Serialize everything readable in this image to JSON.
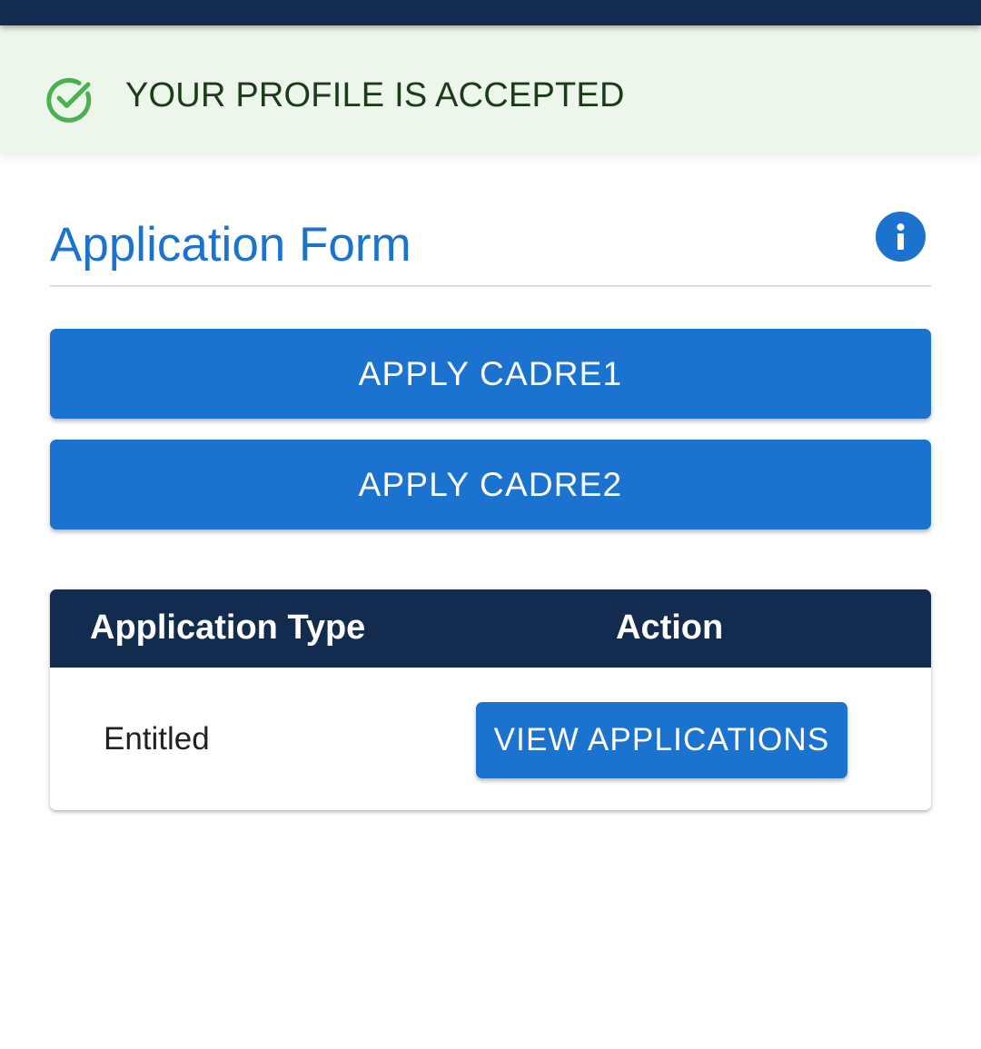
{
  "status_banner": {
    "icon": "check-circle-icon",
    "text": "YOUR PROFILE IS ACCEPTED",
    "color": "#4caf50",
    "background": "#ecf6ea"
  },
  "form": {
    "title": "Application Form",
    "info_icon": "info-icon"
  },
  "actions": {
    "apply_cadre1": "APPLY CADRE1",
    "apply_cadre2": "APPLY CADRE2"
  },
  "table": {
    "columns": [
      "Application Type",
      "Action"
    ],
    "rows": [
      {
        "type": "Entitled",
        "action": "VIEW APPLICATIONS"
      }
    ]
  },
  "colors": {
    "primary": "#1b73cf",
    "header_navy": "#132b4f",
    "success_green": "#4caf50"
  }
}
